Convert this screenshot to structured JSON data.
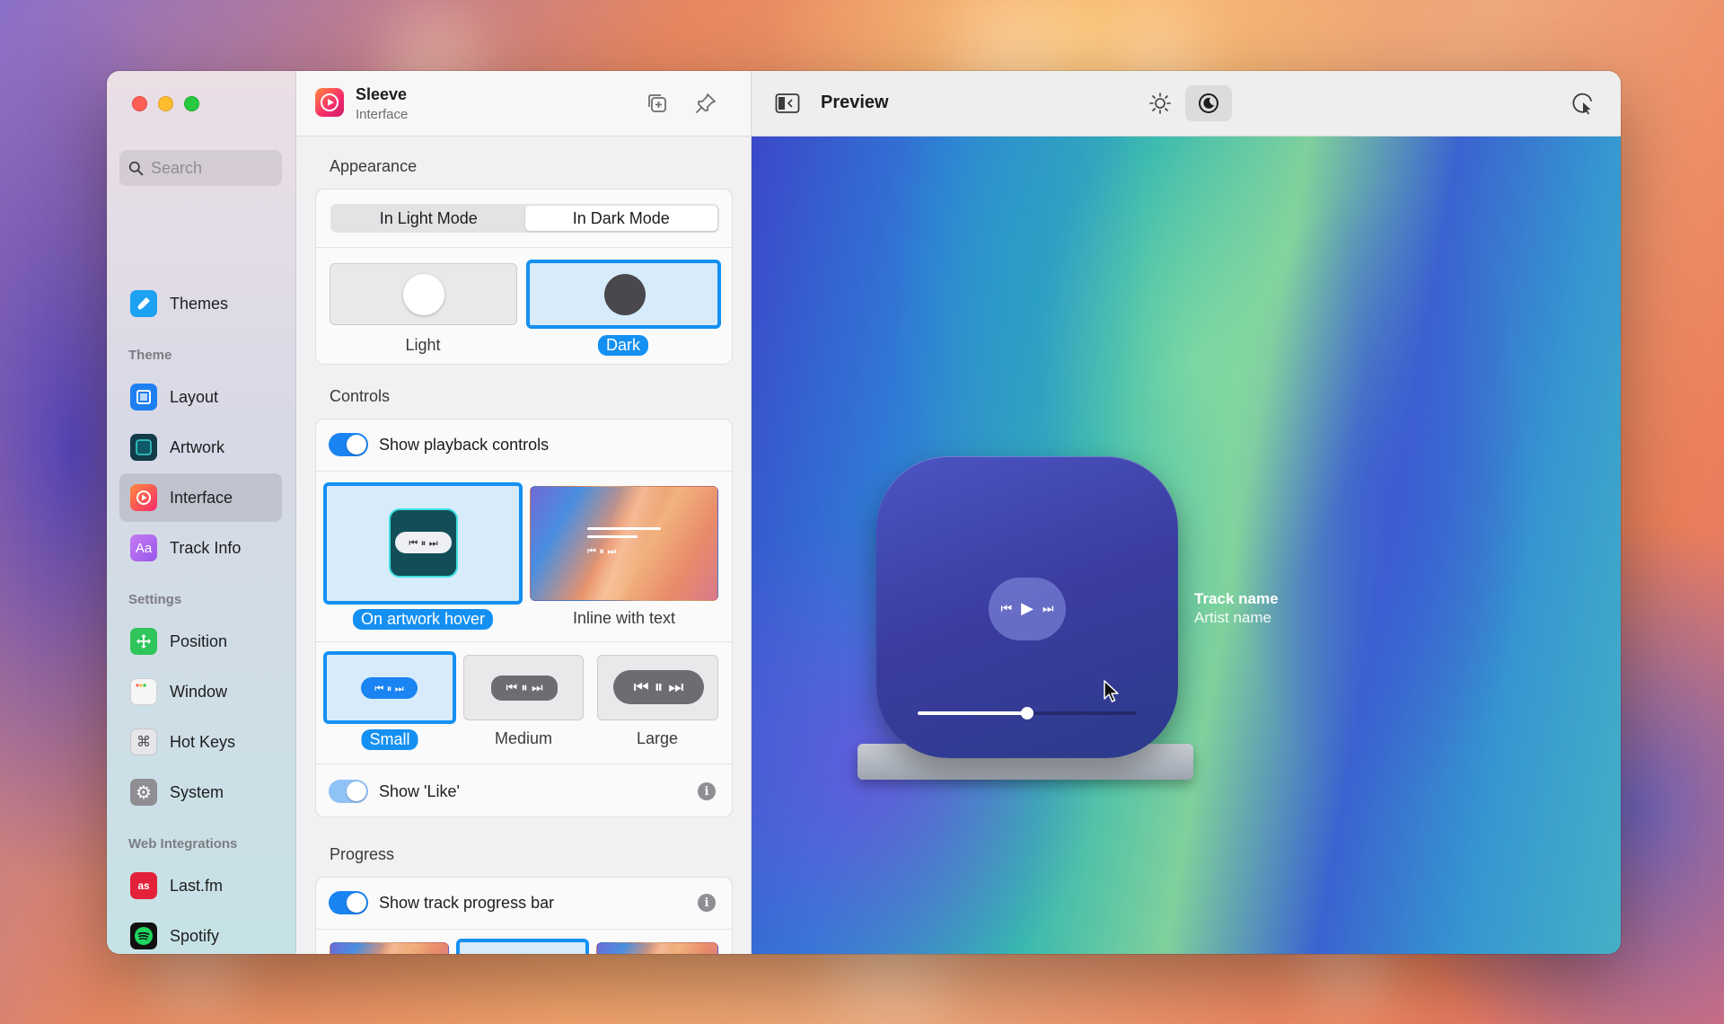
{
  "sidebar": {
    "search_placeholder": "Search",
    "top_item": {
      "label": "Themes",
      "icon": "paintbrush-icon",
      "color": "#1da1f2"
    },
    "sections": [
      {
        "title": "Theme"
      },
      {
        "title": "Settings"
      },
      {
        "title": "Web Integrations"
      }
    ],
    "theme_items": [
      {
        "label": "Layout",
        "icon": "layout-icon",
        "color": "#1d7ff2"
      },
      {
        "label": "Artwork",
        "icon": "artwork-icon",
        "color": "#133c49"
      },
      {
        "label": "Interface",
        "icon": "interface-icon",
        "color": "#f72a6b",
        "active": true
      },
      {
        "label": "Track Info",
        "icon": "text-aa-icon",
        "color": "#b56ef0"
      }
    ],
    "settings_items": [
      {
        "label": "Position",
        "icon": "move-arrows-icon",
        "color": "#2fc55a"
      },
      {
        "label": "Window",
        "icon": "window-icon",
        "color": "#f3f3f3"
      },
      {
        "label": "Hot Keys",
        "icon": "command-key-icon",
        "color": "#e3e3e6"
      },
      {
        "label": "System",
        "icon": "gear-icon",
        "color": "#8e8e93"
      }
    ],
    "web_items": [
      {
        "label": "Last.fm",
        "icon": "lastfm-icon",
        "color": "#e3213a"
      },
      {
        "label": "Spotify",
        "icon": "spotify-icon",
        "color": "#1ed760"
      }
    ]
  },
  "panel": {
    "app_name": "Sleeve",
    "page_name": "Interface",
    "appearance": {
      "title": "Appearance",
      "segments": [
        "In Light Mode",
        "In Dark Mode"
      ],
      "selected_segment": "In Dark Mode",
      "options": [
        {
          "label": "Light",
          "selected": false
        },
        {
          "label": "Dark",
          "selected": true
        }
      ]
    },
    "controls": {
      "title": "Controls",
      "show_playback_label": "Show playback controls",
      "show_playback_on": true,
      "placement_options": [
        {
          "label": "On artwork hover",
          "selected": true
        },
        {
          "label": "Inline with text",
          "selected": false
        }
      ],
      "size_options": [
        {
          "label": "Small",
          "selected": true
        },
        {
          "label": "Medium",
          "selected": false
        },
        {
          "label": "Large",
          "selected": false
        }
      ],
      "show_like_label": "Show 'Like'",
      "show_like_on": true
    },
    "progress": {
      "title": "Progress",
      "show_bar_label": "Show track progress bar",
      "show_bar_on": true
    }
  },
  "preview": {
    "title": "Preview",
    "mode_selected": "dark",
    "track_name": "Track name",
    "artist_name": "Artist name",
    "progress_fraction": 0.5
  },
  "colors": {
    "accent": "#1490f2",
    "toggle_on": "#1a84f2"
  }
}
